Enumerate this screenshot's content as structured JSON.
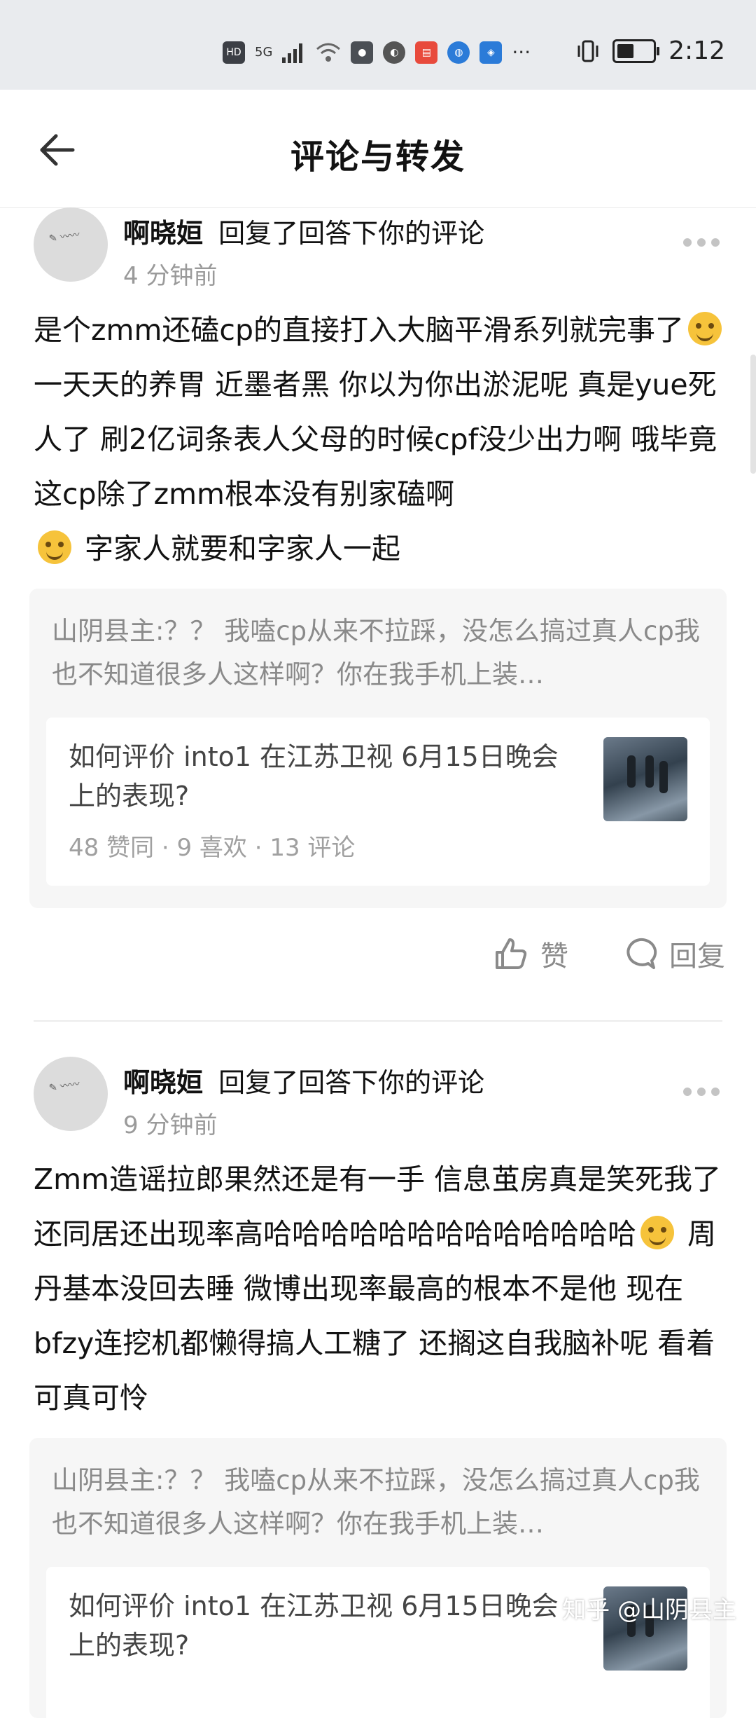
{
  "status_bar": {
    "network": "HD",
    "signal": "5G",
    "time": "2:12"
  },
  "header": {
    "title": "评论与转发"
  },
  "comments": [
    {
      "username": "啊晓姮",
      "action": "回复了回答下你的评论",
      "time": "4 分钟前",
      "content_parts": [
        "是个zmm还磕cp的直接打入大脑平滑系列就完事了",
        " 一天天的养胃 近墨者黑 你以为你出淤泥呢 真是yue死人了 刷2亿词条表人父母的时候cpf没少出力啊 哦毕竟这cp除了zmm根本没有别家磕啊",
        " 字家人就要和字家人一起"
      ],
      "quote": "山阴县主:？？ 我嗑cp从来不拉踩，没怎么搞过真人cp我也不知道很多人这样啊？你在我手机上装…",
      "card": {
        "title": "如何评价 into1 在江苏卫视 6月15日晚会上的表现?",
        "meta": "48 赞同 · 9 喜欢 · 13 评论"
      },
      "like_label": "赞",
      "reply_label": "回复"
    },
    {
      "username": "啊晓姮",
      "action": "回复了回答下你的评论",
      "time": "9 分钟前",
      "content_parts": [
        "Zmm造谣拉郎果然还是有一手 信息茧房真是笑死我了 还同居还出现率高哈哈哈哈哈哈哈哈哈哈哈哈哈",
        " 周丹基本没回去睡 微博出现率最高的根本不是他 现在bfzy连挖机都懒得搞人工糖了 还搁这自我脑补呢 看着可真可怜"
      ],
      "quote": "山阴县主:？？ 我嗑cp从来不拉踩，没怎么搞过真人cp我也不知道很多人这样啊？你在我手机上装…",
      "card": {
        "title": "如何评价 into1 在江苏卫视 6月15日晚会上的表现?"
      }
    }
  ],
  "watermark": "知乎 @山阴县主"
}
